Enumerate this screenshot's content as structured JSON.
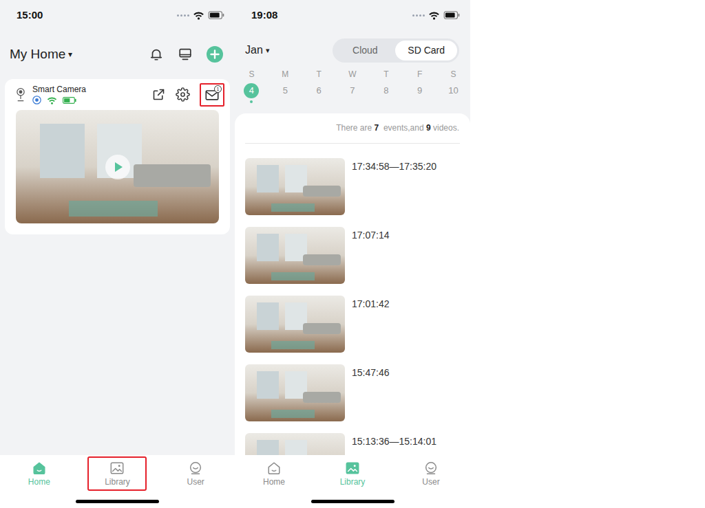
{
  "home_screen": {
    "status_bar": {
      "time": "15:00"
    },
    "header": {
      "title": "My Home",
      "caret": "▾"
    },
    "camera_card": {
      "name": "Smart Camera",
      "mail_badge": "1",
      "mail_highlighted": true
    },
    "tab_bar": [
      {
        "label": "Home",
        "selected": true,
        "highlighted": false
      },
      {
        "label": "Library",
        "selected": false,
        "highlighted": true
      },
      {
        "label": "User",
        "selected": false,
        "highlighted": false
      }
    ]
  },
  "library_screen": {
    "status_bar": {
      "time": "19:08"
    },
    "month": {
      "label": "Jan",
      "caret": "▾"
    },
    "source_tabs": [
      {
        "label": "Cloud",
        "selected": false
      },
      {
        "label": "SD Card",
        "selected": true
      }
    ],
    "weekdays": [
      "S",
      "M",
      "T",
      "W",
      "T",
      "F",
      "S"
    ],
    "dates": [
      {
        "label": "4",
        "selected": true,
        "has_records": true
      },
      {
        "label": "5",
        "selected": false,
        "has_records": false
      },
      {
        "label": "6",
        "selected": false,
        "has_records": false
      },
      {
        "label": "7",
        "selected": false,
        "has_records": false
      },
      {
        "label": "8",
        "selected": false,
        "has_records": false
      },
      {
        "label": "9",
        "selected": false,
        "has_records": false
      },
      {
        "label": "10",
        "selected": false,
        "has_records": false
      }
    ],
    "summary": {
      "prefix": "There are ",
      "events": "7",
      "middle": "  events,and ",
      "videos": "9",
      "suffix": " videos."
    },
    "recordings": [
      {
        "time": "17:34:58—17:35:20"
      },
      {
        "time": "17:07:14"
      },
      {
        "time": "17:01:42"
      },
      {
        "time": "15:47:46"
      },
      {
        "time": "15:13:36—15:14:01"
      }
    ],
    "tab_bar": [
      {
        "label": "Home",
        "selected": false,
        "highlighted": false
      },
      {
        "label": "Library",
        "selected": true,
        "highlighted": false
      },
      {
        "label": "User",
        "selected": false,
        "highlighted": false
      }
    ]
  }
}
